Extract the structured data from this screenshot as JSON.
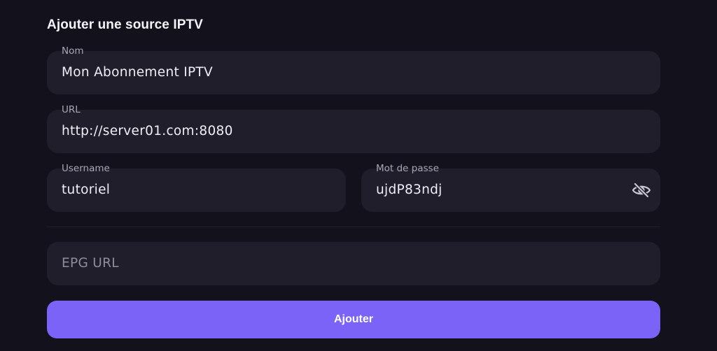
{
  "form": {
    "title": "Ajouter une source IPTV",
    "fields": {
      "name": {
        "label": "Nom",
        "value": "Mon Abonnement IPTV"
      },
      "url": {
        "label": "URL",
        "value": "http://server01.com:8080"
      },
      "username": {
        "label": "Username",
        "value": "tutoriel"
      },
      "password": {
        "label": "Mot de passe",
        "value": "ujdP83ndj",
        "visibility_icon": "eye-off-icon"
      },
      "epg": {
        "placeholder": "EPG URL"
      }
    },
    "submit_label": "Ajouter"
  },
  "colors": {
    "background": "#13111c",
    "field_background": "#201e2b",
    "accent": "#7a63f6"
  }
}
